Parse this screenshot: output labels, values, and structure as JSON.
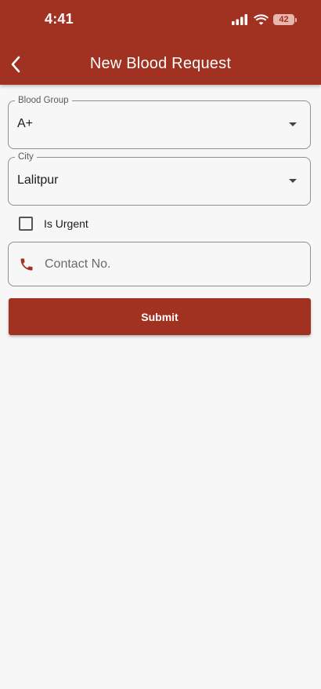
{
  "status_bar": {
    "time": "4:41",
    "battery_level": "42"
  },
  "app_bar": {
    "title": "New Blood Request",
    "color": "#a13120"
  },
  "form": {
    "blood_group": {
      "label": "Blood Group",
      "value": "A+"
    },
    "city": {
      "label": "City",
      "value": "Lalitpur"
    },
    "urgent": {
      "label": "Is Urgent",
      "checked": false
    },
    "contact": {
      "placeholder": "Contact No.",
      "value": "",
      "icon": "phone-icon"
    },
    "submit_label": "Submit"
  }
}
